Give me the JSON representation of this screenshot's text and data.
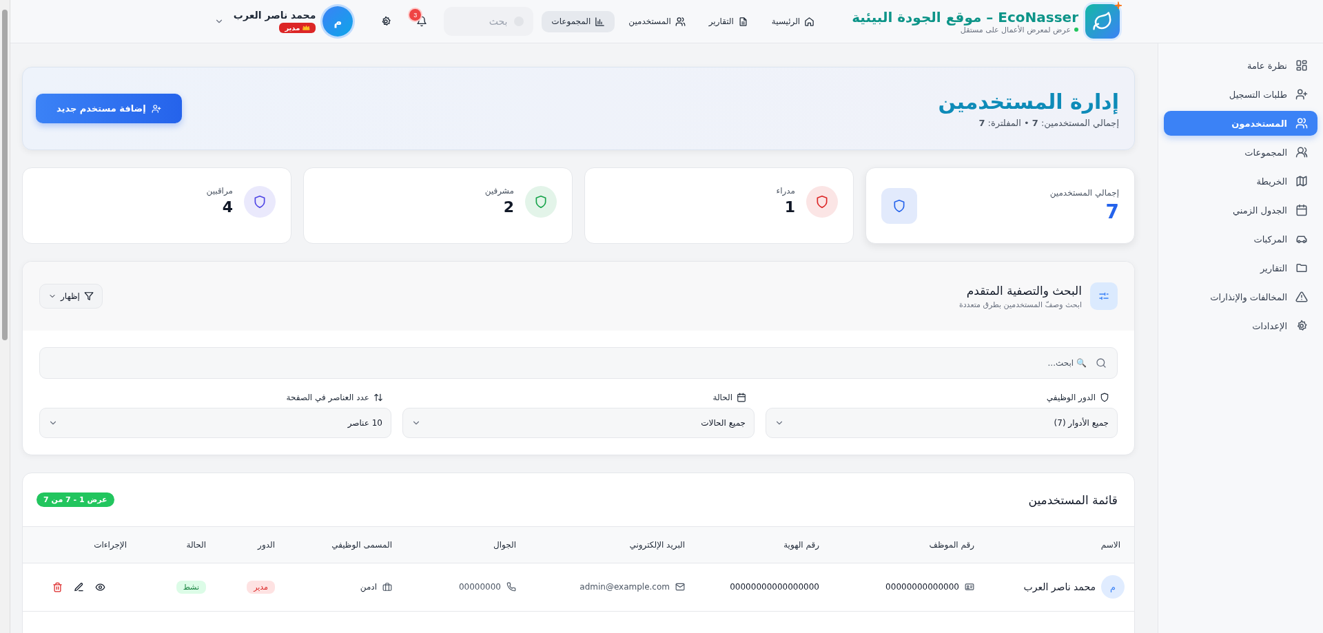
{
  "brand": {
    "title": "EcoNasser – موقع الجودة البيئية",
    "subtitle": "عرض لمعرض الأعمال على مستقل",
    "online": true
  },
  "nav": [
    {
      "label": "الرئيسية",
      "hovered": false
    },
    {
      "label": "التقارير",
      "hovered": false
    },
    {
      "label": "المستخدمين",
      "hovered": false
    },
    {
      "label": "المجموعات",
      "hovered": true
    }
  ],
  "search": {
    "placeholder": "بحث"
  },
  "notifications": {
    "count": "3"
  },
  "user": {
    "initial": "م",
    "name": "محمد ناصر العرب",
    "role": "مدير"
  },
  "sidebar": {
    "items": [
      {
        "label": "نظرة عامة",
        "selected": false
      },
      {
        "label": "طلبات التسجيل",
        "selected": false
      },
      {
        "label": "المستخدمون",
        "selected": true
      },
      {
        "label": "المجموعات",
        "selected": false
      },
      {
        "label": "الخريطة",
        "selected": false
      },
      {
        "label": "الجدول الزمني",
        "selected": false
      },
      {
        "label": "المركبات",
        "selected": false
      },
      {
        "label": "التقارير",
        "selected": false
      },
      {
        "label": "المخالفات والإنذارات",
        "selected": false
      },
      {
        "label": "الإعدادات",
        "selected": false
      }
    ]
  },
  "page_header": {
    "title": "إدارة المستخدمين",
    "summary": "إجمالي المستخدمين: **7** • المفلترة: **7**",
    "add_button": "إضافة مستخدم جديد"
  },
  "stats": [
    {
      "label": "إجمالي المستخدمين",
      "value": "7",
      "color": "#2563eb",
      "featured": true
    },
    {
      "label": "مدراء",
      "value": "1",
      "color": "#dc2626",
      "featured": false
    },
    {
      "label": "مشرفين",
      "value": "2",
      "color": "#16a34a",
      "featured": false
    },
    {
      "label": "مراقبين",
      "value": "4",
      "color": "#4f46e5",
      "featured": false
    }
  ],
  "filters": {
    "title": "البحث والتصفية المتقدم",
    "subtitle": "ابحث وصفّ المستخدمين بطرق متعددة",
    "toggle": "إظهار",
    "search_placeholder": "🔍 ابحث...",
    "selects": [
      {
        "label": "الدور الوظيفي",
        "value": "جميع الأدوار (7)"
      },
      {
        "label": "الحالة",
        "value": "جميع الحالات"
      },
      {
        "label": "عدد العناصر في الصفحة",
        "value": "10 عناصر"
      }
    ]
  },
  "table": {
    "title": "قائمة المستخدمين",
    "range": "عرض 1 - 7 من 7",
    "columns": [
      "الاسم",
      "رقم الموظف",
      "رقم الهوية",
      "البريد الإلكتروني",
      "الجوال",
      "المسمى الوظيفي",
      "الدور",
      "الحالة",
      "الإجراءات"
    ],
    "rows": [
      {
        "initial": "م",
        "name": "محمد ناصر العرب",
        "employee_no": "00000000000000",
        "national_id": "00000000000000000",
        "email": "admin@example.com",
        "phone": "00000000",
        "job_title": "ادمن",
        "role": "مدير",
        "status": "نشط"
      }
    ]
  }
}
